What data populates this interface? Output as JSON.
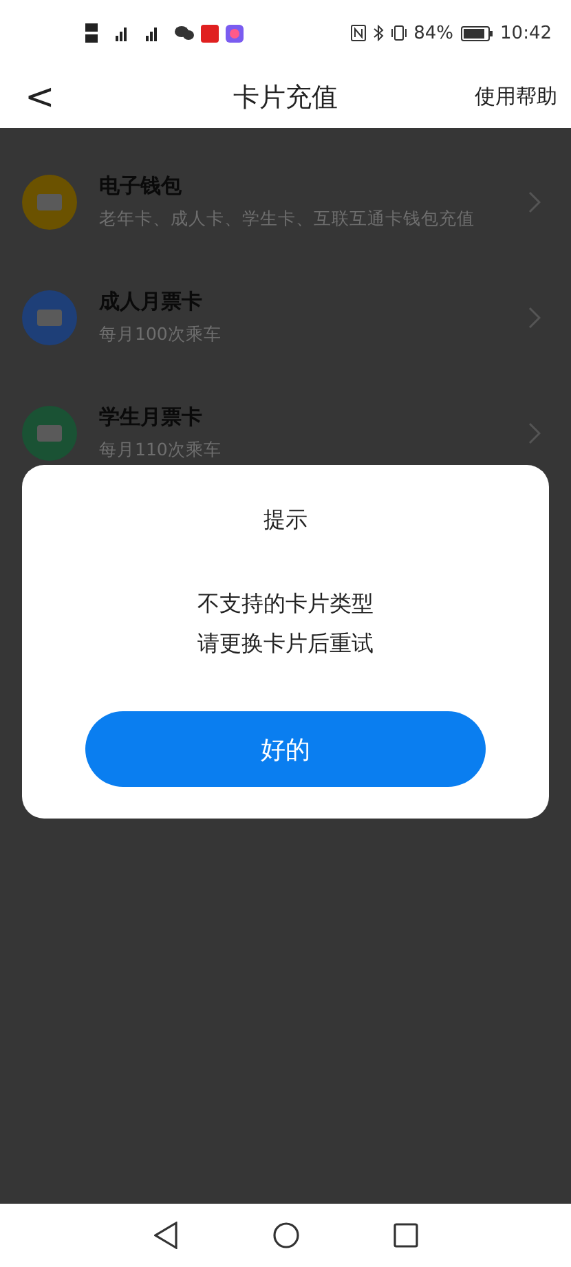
{
  "status_bar": {
    "battery": "84%",
    "time": "10:42"
  },
  "header": {
    "back": "<",
    "title": "卡片充值",
    "help": "使用帮助"
  },
  "cards": [
    {
      "title": "电子钱包",
      "subtitle": "老年卡、成人卡、学生卡、互联互通卡钱包充值",
      "color": "#6b5200"
    },
    {
      "title": "成人月票卡",
      "subtitle": "每月100次乘车",
      "color": "#1e3f78"
    },
    {
      "title": "学生月票卡",
      "subtitle": "每月110次乘车",
      "color": "#1a5234"
    }
  ],
  "dialog": {
    "title": "提示",
    "lines": [
      "不支持的卡片类型",
      "请更换卡片后重试"
    ],
    "button": "好的"
  }
}
